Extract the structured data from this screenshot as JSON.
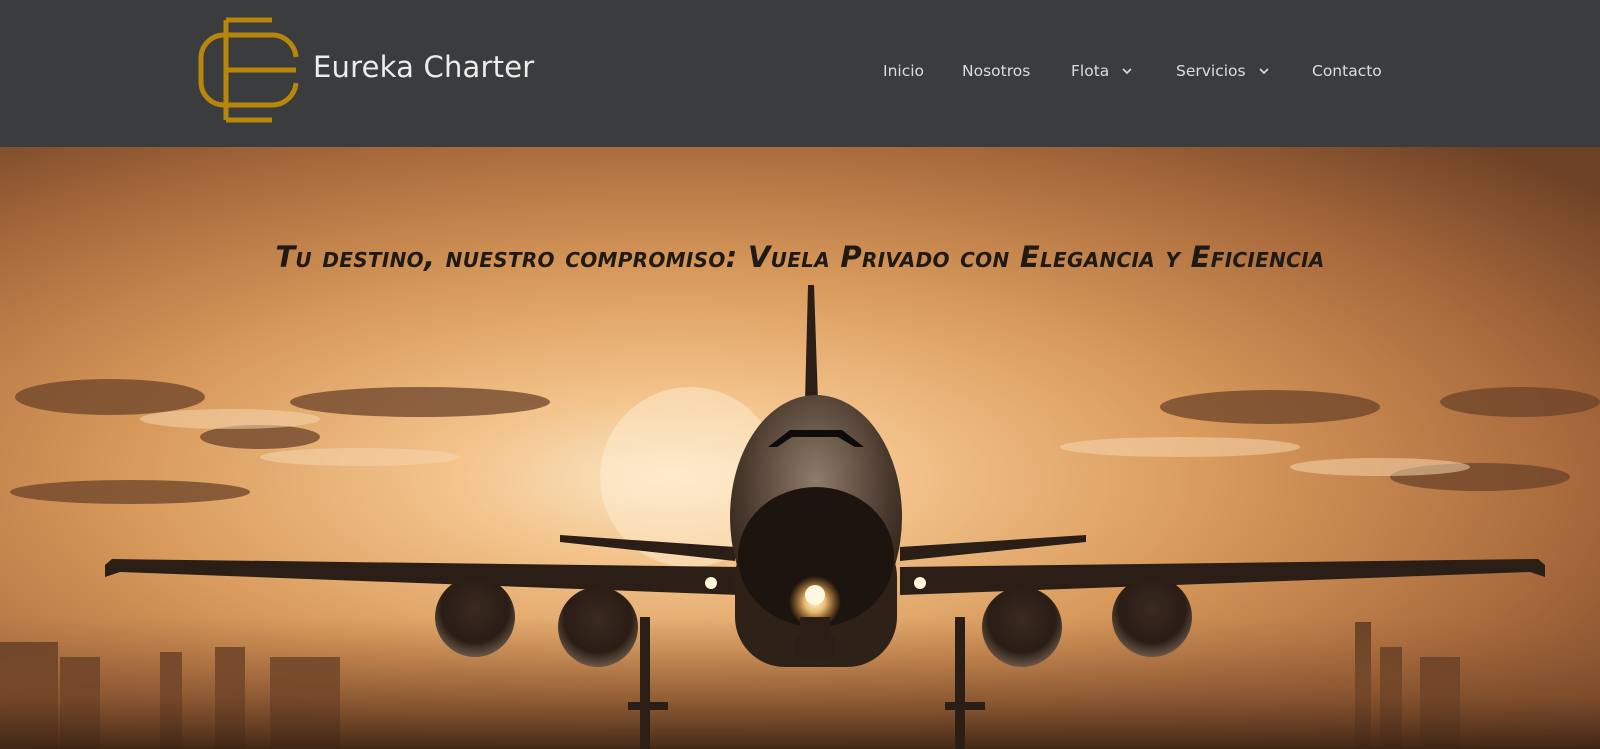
{
  "brand": {
    "name": "Eureka Charter",
    "accent_color": "#b8860b",
    "logo_icon": "ec-monogram-icon"
  },
  "nav": {
    "items": [
      {
        "label": "Inicio",
        "has_dropdown": false
      },
      {
        "label": "Nosotros",
        "has_dropdown": false
      },
      {
        "label": "Flota",
        "has_dropdown": true
      },
      {
        "label": "Servicios",
        "has_dropdown": true
      },
      {
        "label": "Contacto",
        "has_dropdown": false
      }
    ],
    "dropdown_icon": "chevron-down-icon"
  },
  "hero": {
    "title": "Tu destino, nuestro compromiso: Vuela Privado con Elegancia y Eficiencia",
    "image": "airplane-landing-at-sunset",
    "colors": {
      "header_bg": "#3b3c3e",
      "sky_glow": "#f6d2a0",
      "sky_edge": "#7a4a28"
    }
  }
}
